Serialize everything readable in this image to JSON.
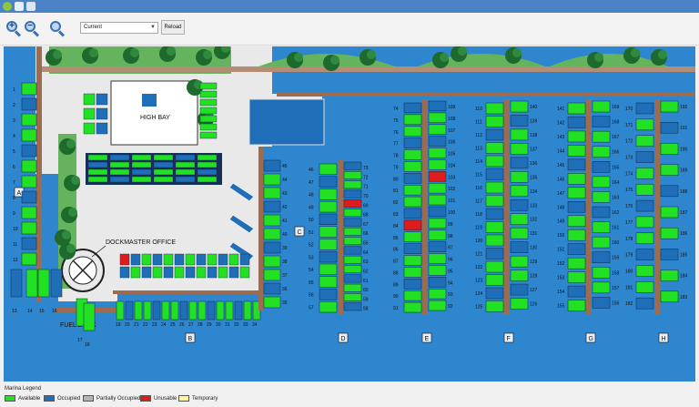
{
  "window": {
    "icons": [
      "app-icon",
      "save-icon",
      "print-icon"
    ]
  },
  "toolbar": {
    "zoom_in_symbol": "+",
    "zoom_out_symbol": "−",
    "zoom_reset_symbol": "",
    "view_select": "Current",
    "reload_label": "Reload"
  },
  "map": {
    "high_bay_label": "HIGH BAY",
    "dockmaster_label": "DOCKMASTER OFFICE",
    "fuel_dock_label": "FUEL DOCK",
    "dock_letters": [
      "A",
      "B",
      "C",
      "D",
      "E",
      "F",
      "G",
      "H"
    ],
    "slip_numbers": [
      "1",
      "2",
      "3",
      "4",
      "5",
      "6",
      "7",
      "8",
      "9",
      "10",
      "11",
      "12",
      "13",
      "14",
      "15",
      "16",
      "17",
      "18",
      "19",
      "20",
      "21",
      "22",
      "23",
      "24",
      "25",
      "26",
      "27",
      "28",
      "29",
      "30",
      "31",
      "32",
      "33",
      "34",
      "35",
      "36",
      "37",
      "38",
      "39",
      "40",
      "41",
      "42",
      "43",
      "44",
      "45",
      "46",
      "47",
      "48",
      "49",
      "50",
      "51",
      "52",
      "53",
      "54",
      "55",
      "56",
      "57",
      "58",
      "59",
      "60",
      "61",
      "62",
      "63",
      "64",
      "65",
      "66",
      "67",
      "68",
      "69",
      "70",
      "71",
      "72",
      "73",
      "74",
      "75",
      "76",
      "77",
      "78",
      "79",
      "80",
      "81",
      "82",
      "83",
      "84",
      "85",
      "86",
      "87",
      "88",
      "89",
      "90",
      "91",
      "92",
      "93",
      "94",
      "95",
      "96",
      "97",
      "98",
      "99",
      "100",
      "101",
      "102",
      "103",
      "104",
      "105",
      "106",
      "107",
      "108",
      "109",
      "110",
      "111",
      "112",
      "113",
      "114",
      "115",
      "116",
      "117",
      "118",
      "119",
      "120",
      "121",
      "122",
      "123",
      "124",
      "125",
      "126",
      "127",
      "128",
      "129",
      "130",
      "131",
      "132",
      "133",
      "134",
      "135",
      "136",
      "137",
      "138",
      "139",
      "140",
      "141",
      "142",
      "143",
      "144",
      "145",
      "146",
      "147",
      "148",
      "149",
      "150",
      "151",
      "152",
      "153",
      "154",
      "155",
      "156",
      "157",
      "158",
      "159",
      "160",
      "161",
      "162",
      "163",
      "164",
      "165",
      "166",
      "167",
      "168",
      "169",
      "170",
      "171",
      "172",
      "173",
      "174",
      "175",
      "176",
      "177",
      "178",
      "179",
      "180",
      "181",
      "182",
      "183",
      "184",
      "185",
      "186",
      "187",
      "188",
      "189",
      "190",
      "191",
      "192",
      "193",
      "194",
      "195",
      "196",
      "197",
      "198",
      "199",
      "200",
      "201",
      "202",
      "203",
      "204",
      "205",
      "206",
      "207",
      "208",
      "209"
    ],
    "unusable_slips": [
      "69",
      "84",
      "103"
    ]
  },
  "legend": {
    "title": "Marina Legend",
    "items": [
      {
        "label": "Available",
        "color": "#22e022"
      },
      {
        "label": "Occupied",
        "color": "#1f6fb8"
      },
      {
        "label": "Partially Occupied",
        "color": "#b5b5b5"
      },
      {
        "label": "Unusable",
        "color": "#e01b1b"
      },
      {
        "label": "Temporary",
        "color": "#fff59a"
      }
    ]
  },
  "colors": {
    "water": "#2e86cf",
    "land": "#e9e9e9",
    "dock": "#9b6b52",
    "available": "#22e022",
    "occupied": "#1f6fb8",
    "unusable": "#e01b1b",
    "grass": "#66b35e",
    "tree": "#1e6a2c"
  }
}
